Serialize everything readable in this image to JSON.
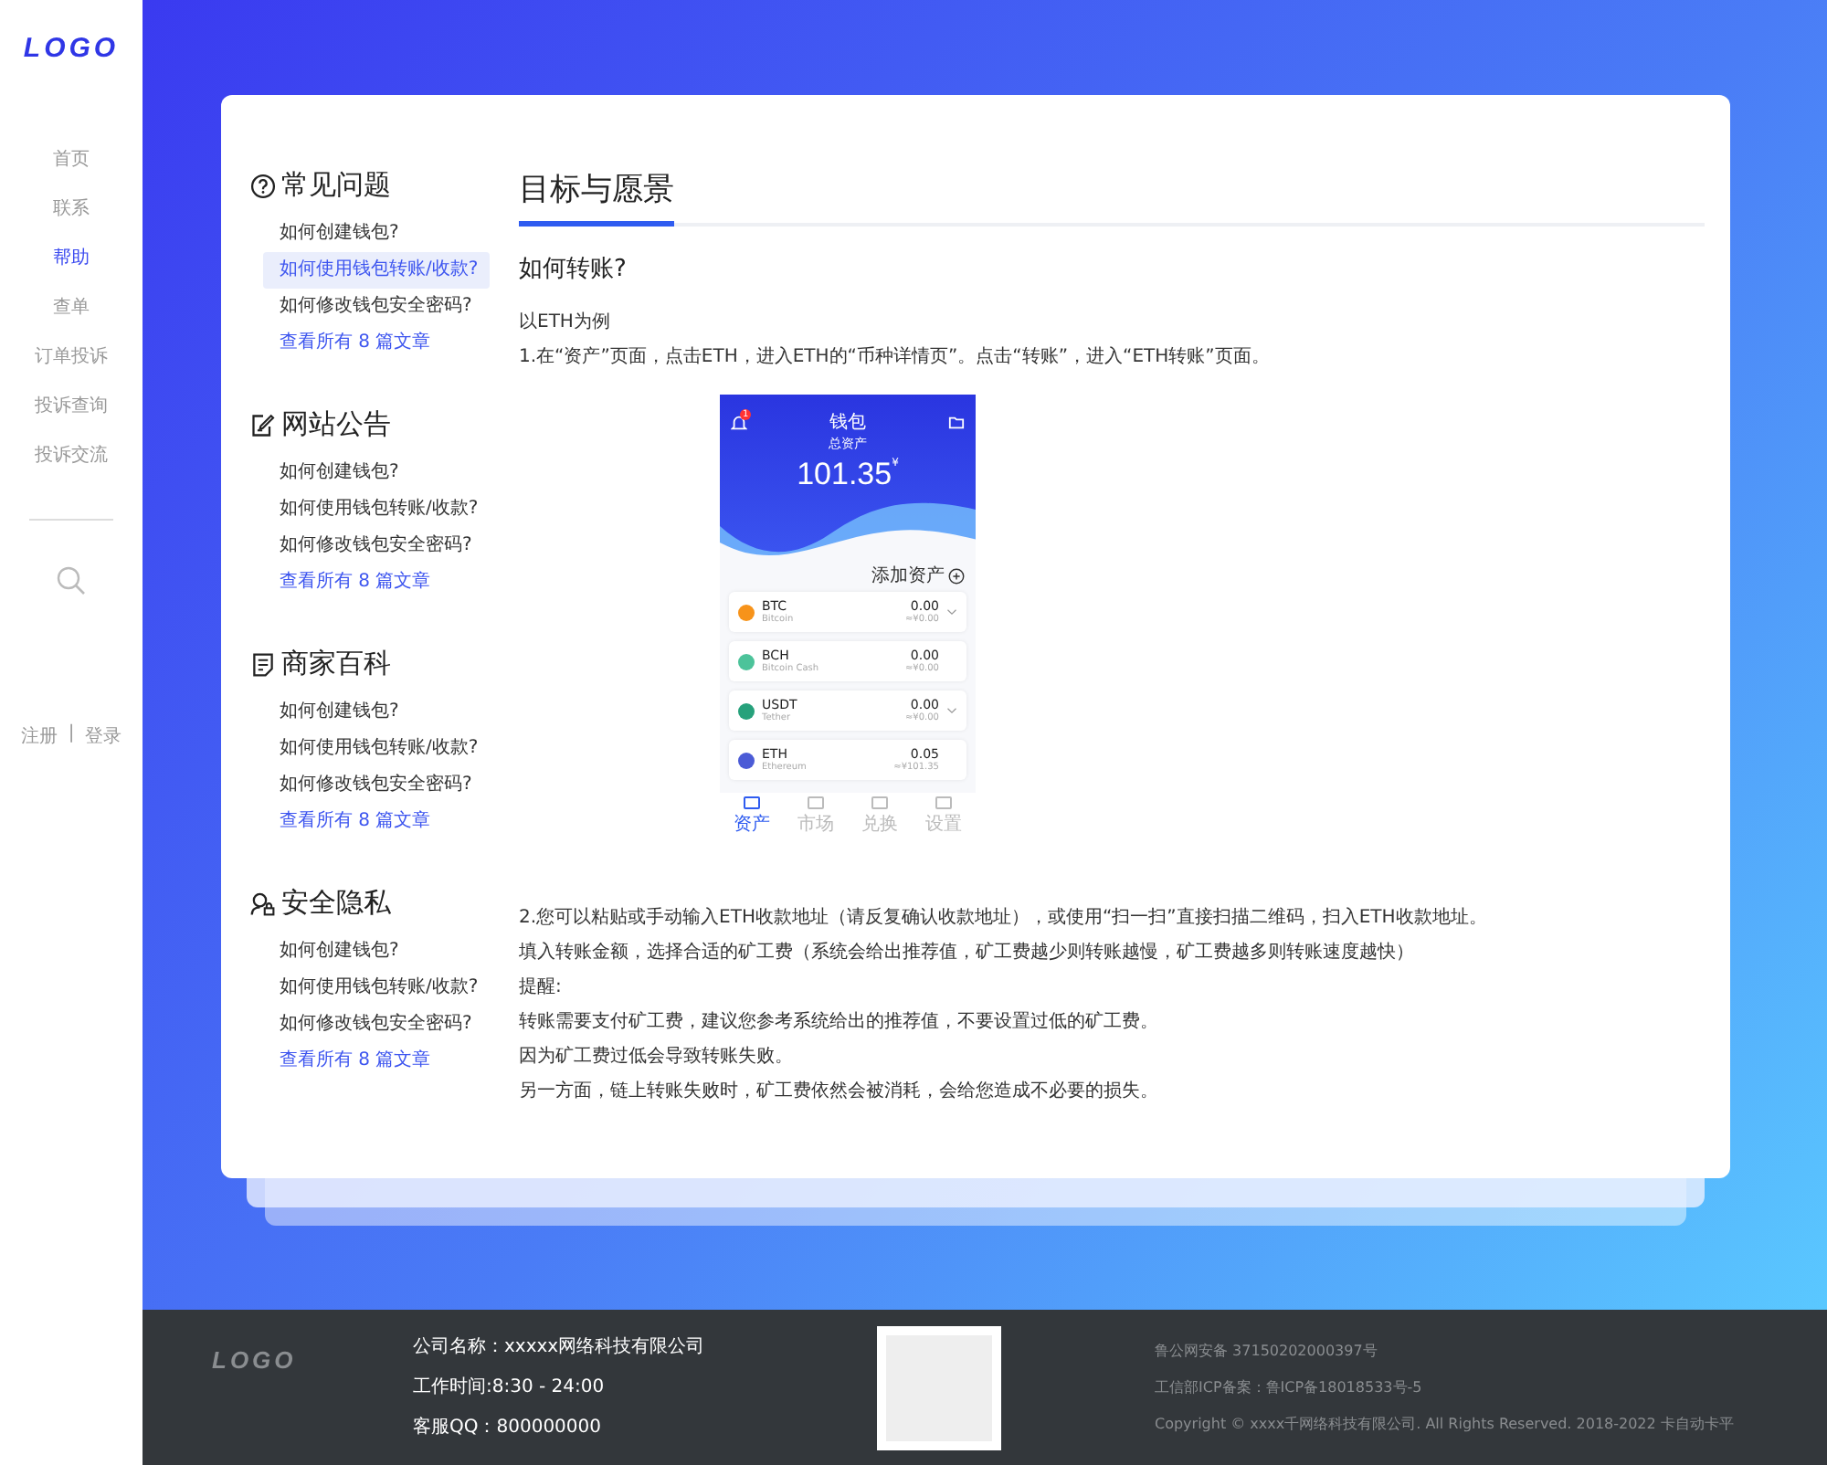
{
  "sidebar": {
    "logo": "LOGO",
    "nav": [
      {
        "label": "首页",
        "selected": false
      },
      {
        "label": "联系",
        "selected": false
      },
      {
        "label": "帮助",
        "selected": true
      },
      {
        "label": "查单",
        "selected": false
      },
      {
        "label": "订单投诉",
        "selected": false
      },
      {
        "label": "投诉查询",
        "selected": false
      },
      {
        "label": "投诉交流",
        "selected": false
      }
    ],
    "auth": {
      "register": "注册",
      "separator": "|",
      "login": "登录"
    }
  },
  "help_sections": [
    {
      "kind": "question",
      "title": "常见问题",
      "items": [
        {
          "label": "如何创建钱包?",
          "selected": false
        },
        {
          "label": "如何使用钱包转账/收款?",
          "selected": true
        },
        {
          "label": "如何修改钱包安全密码?",
          "selected": false
        }
      ],
      "more": "查看所有 8 篇文章"
    },
    {
      "kind": "edit",
      "title": "网站公告",
      "items": [
        {
          "label": "如何创建钱包?",
          "selected": false
        },
        {
          "label": "如何使用钱包转账/收款?",
          "selected": false
        },
        {
          "label": "如何修改钱包安全密码?",
          "selected": false
        }
      ],
      "more": "查看所有 8 篇文章"
    },
    {
      "kind": "document",
      "title": "商家百科",
      "items": [
        {
          "label": "如何创建钱包?",
          "selected": false
        },
        {
          "label": "如何使用钱包转账/收款?",
          "selected": false
        },
        {
          "label": "如何修改钱包安全密码?",
          "selected": false
        }
      ],
      "more": "查看所有 8 篇文章"
    },
    {
      "kind": "privacy",
      "title": "安全隐私",
      "items": [
        {
          "label": "如何创建钱包?",
          "selected": false
        },
        {
          "label": "如何使用钱包转账/收款?",
          "selected": false
        },
        {
          "label": "如何修改钱包安全密码?",
          "selected": false
        }
      ],
      "more": "查看所有 8 篇文章"
    }
  ],
  "article": {
    "tab": "目标与愿景",
    "heading": "如何转账?",
    "intro": [
      "以ETH为例",
      "1.在“资产”页面，点击ETH，进入ETH的“币种详情页”。点击“转账”，进入“ETH转账”页面。"
    ],
    "phone": {
      "title": "钱包",
      "badge": "1",
      "total_label": "总资产",
      "total": "101.35",
      "currency": "¥",
      "add_label": "添加资产",
      "coins": [
        {
          "symbol": "BTC",
          "name": "Bitcoin",
          "amount": "0.00",
          "value": "≈¥0.00",
          "color": "#f7931a",
          "expandable": true
        },
        {
          "symbol": "BCH",
          "name": "Bitcoin Cash",
          "amount": "0.00",
          "value": "≈¥0.00",
          "color": "#4cc39a",
          "expandable": false
        },
        {
          "symbol": "USDT",
          "name": "Tether",
          "amount": "0.00",
          "value": "≈¥0.00",
          "color": "#26a17b",
          "expandable": true
        },
        {
          "symbol": "ETH",
          "name": "Ethereum",
          "amount": "0.05",
          "value": "≈¥101.35",
          "color": "#4b5bd6",
          "expandable": false
        }
      ],
      "tabs": [
        {
          "label": "资产",
          "selected": true
        },
        {
          "label": "市场",
          "selected": false
        },
        {
          "label": "兑换",
          "selected": false
        },
        {
          "label": "设置",
          "selected": false
        }
      ]
    },
    "steps": [
      "2.您可以粘贴或手动输入ETH收款地址（请反复确认收款地址），或使用“扫一扫”直接扫描二维码，扫入ETH收款地址。",
      "填入转账金额，选择合适的矿工费（系统会给出推荐值，矿工费越少则转账越慢，矿工费越多则转账速度越快）",
      "提醒:",
      "转账需要支付矿工费，建议您参考系统给出的推荐值，不要设置过低的矿工费。",
      "因为矿工费过低会导致转账失败。",
      "另一方面，链上转账失败时，矿工费依然会被消耗，会给您造成不必要的损失。"
    ]
  },
  "footer": {
    "logo": "LOGO",
    "company": [
      "公司名称：xxxxx网络科技有限公司",
      "工作时间:8:30 - 24:00",
      "客服QQ：800000000"
    ],
    "legal": [
      "鲁公网安备 37150202000397号",
      "工信部ICP备案：鲁ICP备18018533号-5",
      "Copyright © xxxx千网络科技有限公司. All Rights Reserved. 2018-2022 卡自动卡平"
    ]
  }
}
